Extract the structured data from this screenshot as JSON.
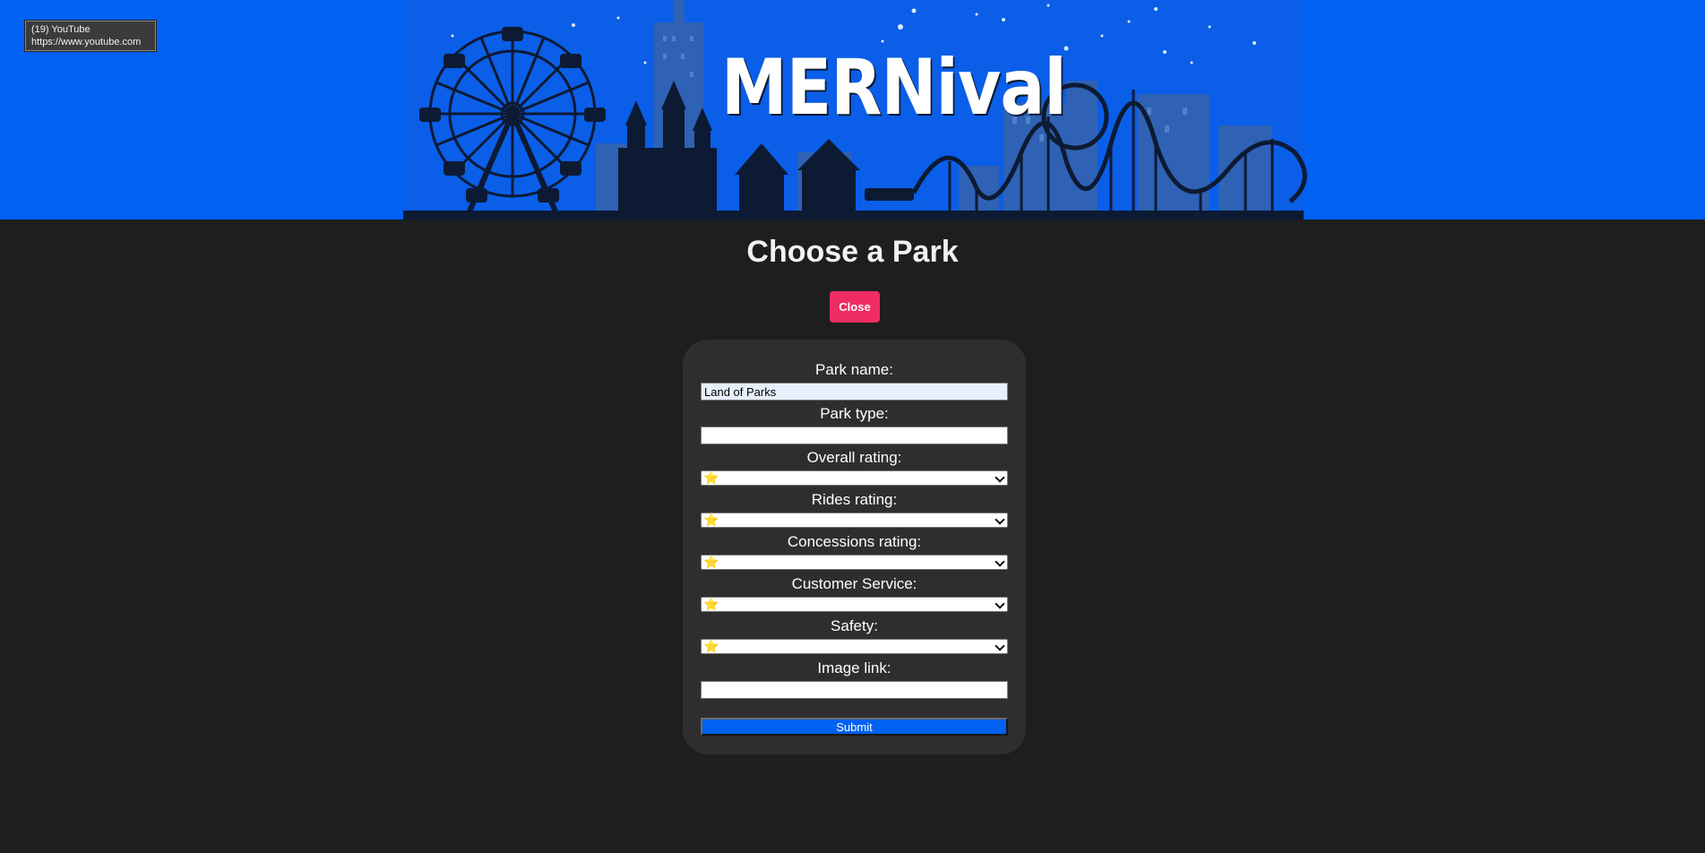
{
  "tooltip": {
    "title": "(19) YouTube",
    "url": "https://www.youtube.com"
  },
  "banner": {
    "logo_text": "MERNival",
    "background": "#0061f2"
  },
  "page": {
    "title": "Choose a Park",
    "close_label": "Close"
  },
  "form": {
    "park_name_label": "Park name:",
    "park_name_value": "Land of Parks",
    "park_type_label": "Park type:",
    "park_type_value": "",
    "overall_label": "Overall rating:",
    "rides_label": "Rides rating:",
    "concessions_label": "Concessions rating:",
    "customer_service_label": "Customer Service:",
    "safety_label": "Safety:",
    "selected_rating": "⭐",
    "image_link_label": "Image link:",
    "image_link_value": "",
    "submit_label": "Submit"
  },
  "colors": {
    "accent_blue": "#0061f2",
    "close_red": "#ee2c62",
    "page_bg": "#1e1e1e",
    "card_bg": "#2e2e2e"
  }
}
